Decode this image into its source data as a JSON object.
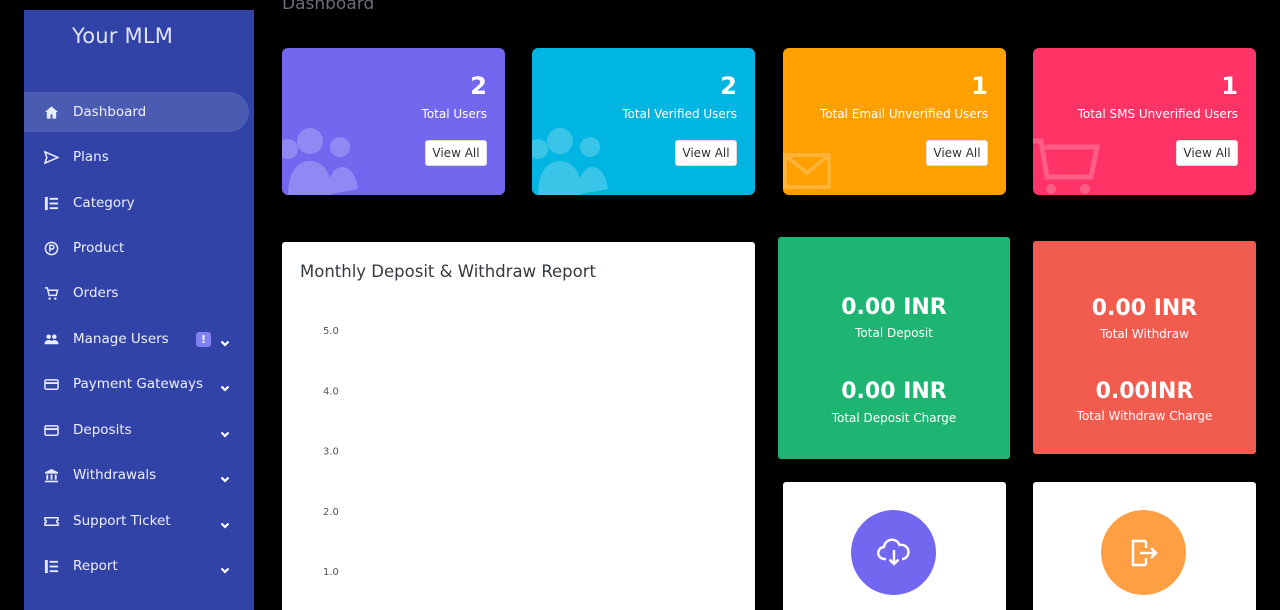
{
  "page": {
    "title": "Dashboard"
  },
  "sidebar": {
    "brand": "Your MLM",
    "items": [
      {
        "label": "Dashboard",
        "icon": "home-icon",
        "active": true
      },
      {
        "label": "Plans",
        "icon": "send-icon"
      },
      {
        "label": "Category",
        "icon": "list-icon"
      },
      {
        "label": "Product",
        "icon": "product-icon"
      },
      {
        "label": "Orders",
        "icon": "cart-icon"
      },
      {
        "label": "Manage Users",
        "icon": "users-icon",
        "badge": "!",
        "has_children": true
      },
      {
        "label": "Payment Gateways",
        "icon": "credit-card-icon",
        "has_children": true
      },
      {
        "label": "Deposits",
        "icon": "credit-card-icon",
        "has_children": true
      },
      {
        "label": "Withdrawals",
        "icon": "bank-icon",
        "has_children": true
      },
      {
        "label": "Support Ticket",
        "icon": "ticket-icon",
        "has_children": true
      },
      {
        "label": "Report",
        "icon": "list-icon",
        "has_children": true
      }
    ]
  },
  "stats": [
    {
      "value": "2",
      "label": "Total Users",
      "button": "View All",
      "color": "#7367f0",
      "icon": "users-bg-icon"
    },
    {
      "value": "2",
      "label": "Total Verified Users",
      "button": "View All",
      "color": "#00b5e2",
      "icon": "users-bg-icon"
    },
    {
      "value": "1",
      "label": "Total Email Unverified Users",
      "button": "View All",
      "color": "#ff9f00",
      "icon": "envelope-bg-icon"
    },
    {
      "value": "1",
      "label": "Total SMS Unverified Users",
      "button": "View All",
      "color": "#ff3366",
      "icon": "cart-bg-icon"
    }
  ],
  "chart": {
    "title": "Monthly Deposit & Withdraw Report"
  },
  "chart_data": {
    "type": "bar",
    "title": "Monthly Deposit & Withdraw Report",
    "y_ticks": [
      "5.0",
      "4.0",
      "3.0",
      "2.0",
      "1.0"
    ],
    "ylim": [
      0,
      5
    ],
    "categories": [],
    "series": []
  },
  "summary": {
    "deposit": {
      "color": "#1eb572",
      "total_value": "0.00 INR",
      "total_label": "Total Deposit",
      "charge_value": "0.00 INR",
      "charge_label": "Total Deposit Charge"
    },
    "withdraw": {
      "color": "#f25c4f",
      "total_value": "0.00 INR",
      "total_label": "Total Withdraw",
      "charge_value": "0.00INR",
      "charge_label": "Total Withdraw Charge"
    }
  },
  "actions": [
    {
      "icon": "cloud-download-icon",
      "color": "#7367f0"
    },
    {
      "icon": "sign-out-icon",
      "color": "#ff9f43"
    }
  ]
}
